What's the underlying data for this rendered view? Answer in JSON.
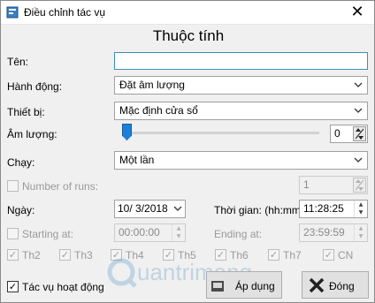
{
  "window": {
    "title": "Điều chỉnh tác vụ",
    "close_glyph": "✕"
  },
  "heading": "Thuộc tính",
  "name": {
    "label": "Tên:",
    "value": ""
  },
  "action": {
    "label": "Hành động:",
    "value": "Đặt âm lượng"
  },
  "device": {
    "label": "Thiết bị:",
    "value": "Mặc định cửa sổ"
  },
  "volume": {
    "label": "Âm lượng:",
    "value": "0",
    "slider_fraction": 0
  },
  "run": {
    "label": "Chạy:",
    "value": "Một lần"
  },
  "number_of_runs": {
    "label": "Number of runs:",
    "value": "1",
    "enabled": false
  },
  "date": {
    "label": "Ngày:",
    "value": "10/ 3/2018"
  },
  "time": {
    "label": "Thời gian: (hh:mm:s",
    "value": "11:28:25"
  },
  "starting_at": {
    "label": "Starting at:",
    "value": "00:00:00",
    "enabled": false
  },
  "ending_at": {
    "label": "Ending at:",
    "value": "23:59:59",
    "enabled": false
  },
  "days": [
    {
      "label": "Th2",
      "checked": true
    },
    {
      "label": "Th3",
      "checked": true
    },
    {
      "label": "Th4",
      "checked": true
    },
    {
      "label": "Th5",
      "checked": true
    },
    {
      "label": "Th6",
      "checked": true
    },
    {
      "label": "Th7",
      "checked": true
    },
    {
      "label": "CN",
      "checked": true
    }
  ],
  "active": {
    "label": "Tác vụ hoạt động",
    "checked": true
  },
  "buttons": {
    "apply": "Áp dụng",
    "close": "Đóng"
  },
  "watermark_text": "uantrimang",
  "icons": {
    "app": "dialog-app-icon",
    "close": "close-icon",
    "dropdown": "chevron-down-icon",
    "spin": "spin-updown-icon",
    "apply": "apply-icon",
    "cancel": "cancel-x-icon"
  },
  "colors": {
    "focus_border": "#3c8fb4",
    "slider_thumb": "#1e7fd6",
    "cancel_red": "#c0392b"
  }
}
